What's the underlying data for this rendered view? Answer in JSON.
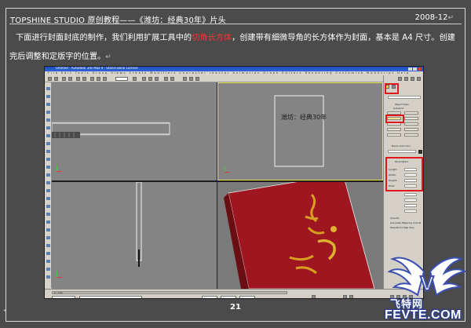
{
  "header": {
    "title": "TOPSHINE STUDIO 原创教程——《潍坊：经典30年》片头",
    "date": "2008-12"
  },
  "body": {
    "para1_before": "下面进行封面封底的制作，我们利用扩展工具中的",
    "para1_highlight": "切角长方体",
    "para1_after": "，创建带有细微导角的长方体作为封面，基本是 A4 尺寸。创建",
    "para2": "完后调整和定版字的位置。",
    "return_mark": "↵"
  },
  "screenshot": {
    "window_title": "Untitled - Autodesk 3ds Max 9 - Stand-alone License",
    "menu": "File  Edit  Tools  Group  Views  Create  Modifiers  Character  reactor  Animation  Graph Editors  Rendering  Customize  MAXScript  Help",
    "cover_text": "潍坊：经典30年",
    "panel": {
      "object_type": "Object Type",
      "autogrid": "AutoGrid",
      "chamferbox": "ChamferBox",
      "name_and_color": "Name and Color",
      "object_name": "ChamferBox01",
      "parameters": "Parameters",
      "length": "Length:",
      "width": "Width:",
      "height": "Height:",
      "fillet": "Fillet:",
      "smooth": "Smooth",
      "gen_mapping": "Generate Mapping Coords.",
      "real_world": "Real-World Map Size"
    },
    "timeline_label": "0 / 100"
  },
  "page_number": "21",
  "watermark": {
    "cn": "飞特网",
    "en": "FEVTE.COM",
    "logo_letter": "V"
  },
  "colors": {
    "background": "#4b4b4b",
    "highlight": "#ff3030",
    "annotation_box": "#e0181c",
    "cover_red": "#9e1620",
    "cover_gold": "#d8a020"
  }
}
